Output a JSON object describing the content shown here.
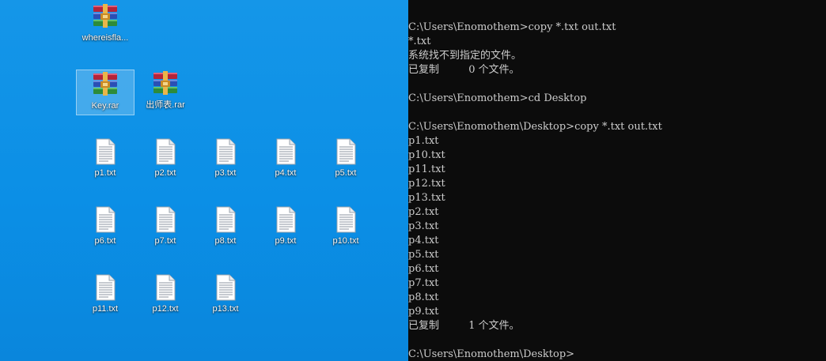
{
  "desktop": {
    "wallpaper_color": "#0b8fe6",
    "archives": [
      {
        "name": "whereisfla...",
        "icon": "winrar-archive-icon",
        "selected": false
      },
      {
        "name": "Key.rar",
        "icon": "winrar-archive-icon",
        "selected": true
      },
      {
        "name": "出师表.rar",
        "icon": "winrar-archive-icon",
        "selected": false
      }
    ],
    "text_files": [
      "p1.txt",
      "p2.txt",
      "p3.txt",
      "p4.txt",
      "p5.txt",
      "p6.txt",
      "p7.txt",
      "p8.txt",
      "p9.txt",
      "p10.txt",
      "p11.txt",
      "p12.txt",
      "p13.txt"
    ]
  },
  "console": {
    "background": "#0c0c0c",
    "foreground": "#cccccc",
    "lines": [
      "",
      "",
      "C:\\Users\\Enomothem>copy *.txt out.txt",
      "*.txt",
      "系统找不到指定的文件。",
      "已复制         0 个文件。",
      "",
      "C:\\Users\\Enomothem>cd Desktop",
      "",
      "C:\\Users\\Enomothem\\Desktop>copy *.txt out.txt",
      "p1.txt",
      "p10.txt",
      "p11.txt",
      "p12.txt",
      "p13.txt",
      "p2.txt",
      "p3.txt",
      "p4.txt",
      "p5.txt",
      "p6.txt",
      "p7.txt",
      "p8.txt",
      "p9.txt",
      "已复制         1 个文件。",
      "",
      "C:\\Users\\Enomothem\\Desktop>"
    ]
  }
}
